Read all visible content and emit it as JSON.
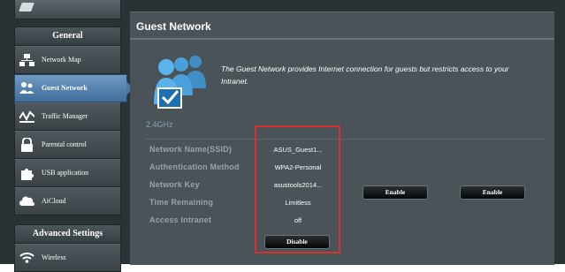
{
  "sidebar": {
    "general_header": "General",
    "advanced_header": "Advanced Settings",
    "items": [
      {
        "label": "Network Map"
      },
      {
        "label": "Guest Network"
      },
      {
        "label": "Traffic Manager"
      },
      {
        "label": "Parental control"
      },
      {
        "label": "USB application"
      },
      {
        "label": "AiCloud"
      },
      {
        "label": "Wireless"
      }
    ]
  },
  "panel": {
    "title": "Guest Network",
    "description": "The Guest Network provides Internet connection for guests but restricts access to your Intranet.",
    "band": "2.4GHz",
    "fields": [
      {
        "label": "Network Name(SSID)",
        "value": "ASUS_Guest1..."
      },
      {
        "label": "Authentication Method",
        "value": "WPA2-Personal"
      },
      {
        "label": "Network Key",
        "value": "asustools2014..."
      },
      {
        "label": "Time Remaining",
        "value": "Limitless"
      },
      {
        "label": "Access Intranet",
        "value": "off"
      }
    ],
    "buttons": {
      "disable": "Disable",
      "enable_1": "Enable",
      "enable_2": "Enable"
    }
  },
  "colors": {
    "background": "#2a3236",
    "panel": "#4a5357",
    "active_nav": "#4a79a6",
    "band_label": "#84a2b8",
    "highlight_box": "#d6312b"
  },
  "icons": [
    "pen-icon",
    "network-map-icon",
    "guest-users-icon",
    "traffic-manager-icon",
    "lock-icon",
    "puzzle-icon",
    "cloud-icon",
    "wifi-icon",
    "guest-network-hero-icon"
  ]
}
